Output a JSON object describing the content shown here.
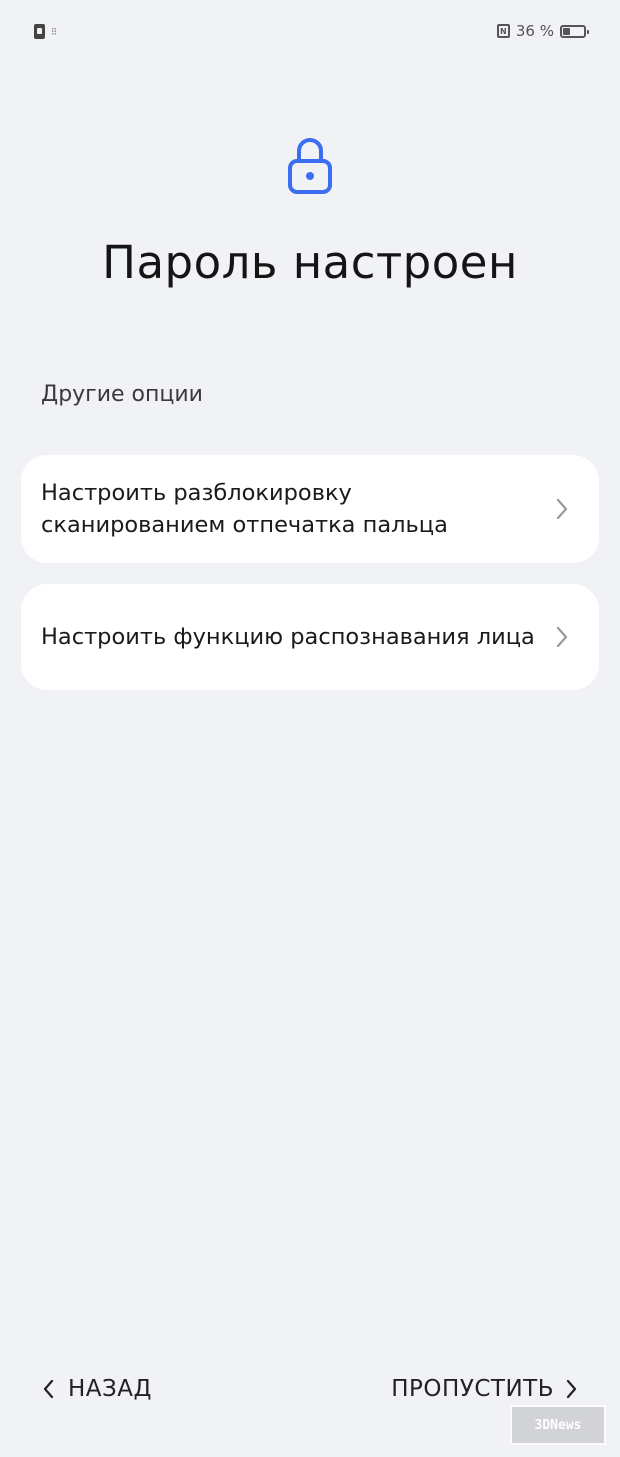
{
  "status_bar": {
    "battery_text": "36 %",
    "battery_level": 0.36,
    "icons": [
      "sim-icon",
      "signal-icon",
      "nfc-icon",
      "battery-icon"
    ]
  },
  "header": {
    "icon": "lock-icon",
    "icon_color": "#3b6ef0",
    "title": "Пароль настроен"
  },
  "other_options": {
    "label": "Другие опции",
    "items": [
      {
        "label": "Настроить разблокировку сканированием отпечатка пальца",
        "icon": "chevron-right-icon"
      },
      {
        "label": "Настроить функцию распознавания лица",
        "icon": "chevron-right-icon"
      }
    ]
  },
  "footer": {
    "back_label": "НАЗАД",
    "skip_label": "ПРОПУСТИТЬ"
  },
  "watermark": {
    "text": "3DNews"
  }
}
